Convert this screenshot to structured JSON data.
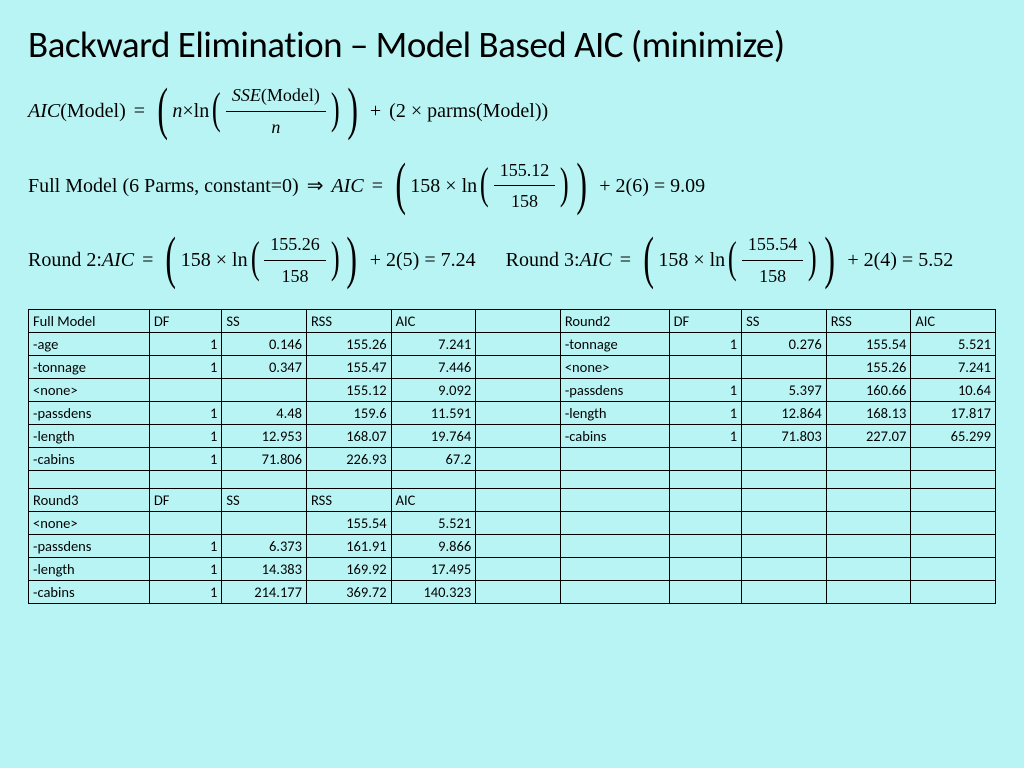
{
  "title": "Backward Elimination – Model Based AIC (minimize)",
  "formula": {
    "aic_lhs": "AIC",
    "model_word": "Model",
    "sse_word": "SSE",
    "n": "n",
    "ln": "ln",
    "plus2parms": "2 × parms(Model)",
    "full_prefix": "Full Model (6 Parms, constant=0)",
    "arrow": "⇒",
    "aic_eq": "AIC",
    "r1_num": "155.12",
    "r1_den": "158",
    "r1_mult": "158 × ln",
    "r1_tail": "+ 2(6) = 9.09",
    "r2_prefix": "Round 2:",
    "r2_num": "155.26",
    "r2_den": "158",
    "r2_mult": "158 × ln",
    "r2_tail": "+ 2(5) = 7.24",
    "r3_prefix": "Round 3:",
    "r3_num": "155.54",
    "r3_den": "158",
    "r3_mult": "158 × ln",
    "r3_tail": "+ 2(4) = 5.52"
  },
  "table": {
    "headers1": [
      "Full Model",
      "DF",
      "SS",
      "RSS",
      "AIC",
      "",
      "Round2",
      "DF",
      "SS",
      "RSS",
      "AIC"
    ],
    "rows1": [
      [
        "-age",
        "1",
        "0.146",
        "155.26",
        "7.241",
        "",
        "-tonnage",
        "1",
        "0.276",
        "155.54",
        "5.521"
      ],
      [
        "-tonnage",
        "1",
        "0.347",
        "155.47",
        "7.446",
        "",
        "<none>",
        "",
        "",
        "155.26",
        "7.241"
      ],
      [
        "<none>",
        "",
        "",
        "155.12",
        "9.092",
        "",
        "-passdens",
        "1",
        "5.397",
        "160.66",
        "10.64"
      ],
      [
        "-passdens",
        "1",
        "4.48",
        "159.6",
        "11.591",
        "",
        "-length",
        "1",
        "12.864",
        "168.13",
        "17.817"
      ],
      [
        "-length",
        "1",
        "12.953",
        "168.07",
        "19.764",
        "",
        "-cabins",
        "1",
        "71.803",
        "227.07",
        "65.299"
      ],
      [
        "-cabins",
        "1",
        "71.806",
        "226.93",
        "67.2",
        "",
        "",
        "",
        "",
        "",
        ""
      ]
    ],
    "blank": [
      "",
      "",
      "",
      "",
      "",
      "",
      "",
      "",
      "",
      "",
      ""
    ],
    "headers2": [
      "Round3",
      "DF",
      "SS",
      "RSS",
      "AIC",
      "",
      "",
      "",
      "",
      "",
      ""
    ],
    "rows2": [
      [
        "<none>",
        "",
        "",
        "155.54",
        "5.521",
        "",
        "",
        "",
        "",
        "",
        ""
      ],
      [
        "-passdens",
        "1",
        "6.373",
        "161.91",
        "9.866",
        "",
        "",
        "",
        "",
        "",
        ""
      ],
      [
        "-length",
        "1",
        "14.383",
        "169.92",
        "17.495",
        "",
        "",
        "",
        "",
        "",
        ""
      ],
      [
        "-cabins",
        "1",
        "214.177",
        "369.72",
        "140.323",
        "",
        "",
        "",
        "",
        "",
        ""
      ]
    ]
  },
  "chart_data": {
    "type": "table",
    "title": "Backward Elimination – Model Based AIC (minimize)",
    "sections": [
      {
        "name": "Full Model",
        "columns": [
          "term",
          "DF",
          "SS",
          "RSS",
          "AIC"
        ],
        "rows": [
          {
            "term": "-age",
            "DF": 1,
            "SS": 0.146,
            "RSS": 155.26,
            "AIC": 7.241
          },
          {
            "term": "-tonnage",
            "DF": 1,
            "SS": 0.347,
            "RSS": 155.47,
            "AIC": 7.446
          },
          {
            "term": "<none>",
            "DF": null,
            "SS": null,
            "RSS": 155.12,
            "AIC": 9.092
          },
          {
            "term": "-passdens",
            "DF": 1,
            "SS": 4.48,
            "RSS": 159.6,
            "AIC": 11.591
          },
          {
            "term": "-length",
            "DF": 1,
            "SS": 12.953,
            "RSS": 168.07,
            "AIC": 19.764
          },
          {
            "term": "-cabins",
            "DF": 1,
            "SS": 71.806,
            "RSS": 226.93,
            "AIC": 67.2
          }
        ]
      },
      {
        "name": "Round2",
        "columns": [
          "term",
          "DF",
          "SS",
          "RSS",
          "AIC"
        ],
        "rows": [
          {
            "term": "-tonnage",
            "DF": 1,
            "SS": 0.276,
            "RSS": 155.54,
            "AIC": 5.521
          },
          {
            "term": "<none>",
            "DF": null,
            "SS": null,
            "RSS": 155.26,
            "AIC": 7.241
          },
          {
            "term": "-passdens",
            "DF": 1,
            "SS": 5.397,
            "RSS": 160.66,
            "AIC": 10.64
          },
          {
            "term": "-length",
            "DF": 1,
            "SS": 12.864,
            "RSS": 168.13,
            "AIC": 17.817
          },
          {
            "term": "-cabins",
            "DF": 1,
            "SS": 71.803,
            "RSS": 227.07,
            "AIC": 65.299
          }
        ]
      },
      {
        "name": "Round3",
        "columns": [
          "term",
          "DF",
          "SS",
          "RSS",
          "AIC"
        ],
        "rows": [
          {
            "term": "<none>",
            "DF": null,
            "SS": null,
            "RSS": 155.54,
            "AIC": 5.521
          },
          {
            "term": "-passdens",
            "DF": 1,
            "SS": 6.373,
            "RSS": 161.91,
            "AIC": 9.866
          },
          {
            "term": "-length",
            "DF": 1,
            "SS": 14.383,
            "RSS": 169.92,
            "AIC": 17.495
          },
          {
            "term": "-cabins",
            "DF": 1,
            "SS": 214.177,
            "RSS": 369.72,
            "AIC": 140.323
          }
        ]
      }
    ],
    "aic_values": {
      "FullModel": 9.09,
      "Round2": 7.24,
      "Round3": 5.52
    }
  }
}
